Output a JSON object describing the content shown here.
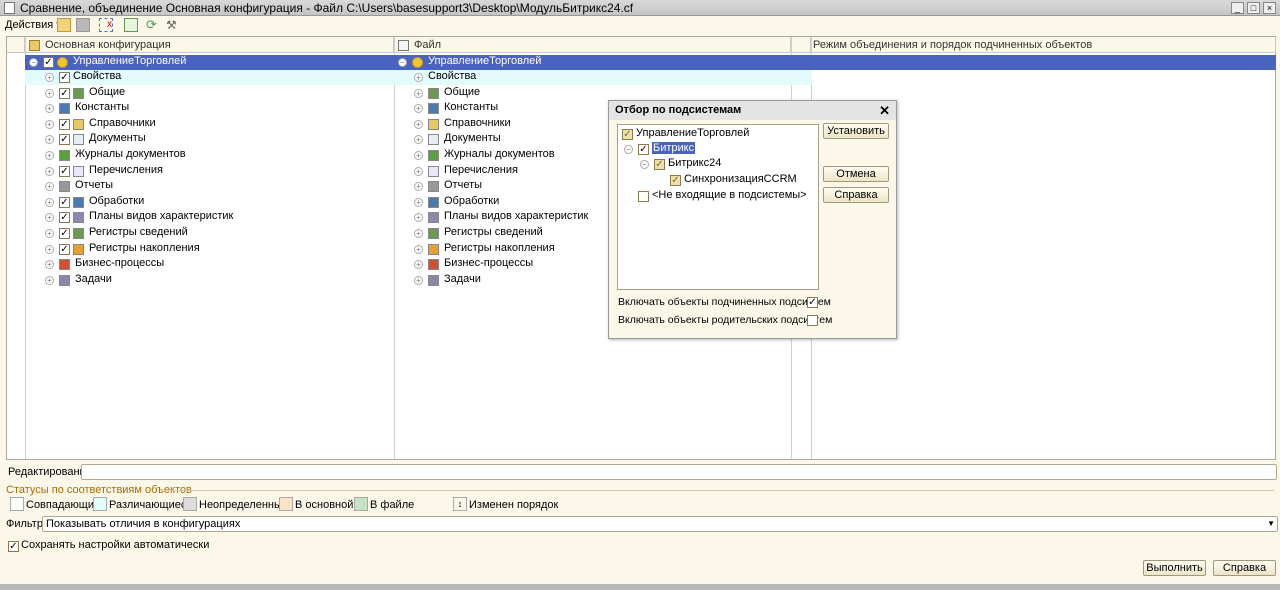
{
  "window": {
    "title": "Сравнение, объединение Основная конфигурация - Файл C:\\Users\\basesupport3\\Desktop\\МодульБитрикс24.cf"
  },
  "toolbar": {
    "actions_label": "Действия ▾",
    "icons": [
      "open-icon",
      "save-icon",
      "compare-icon",
      "subsystem-filter-icon",
      "refresh-icon",
      "settings-icon"
    ]
  },
  "tree": {
    "columns": [
      "Основная конфигурация",
      "Файл",
      "Режим объединения и порядок подчиненных объектов"
    ],
    "root": "УправлениеТорговлей",
    "items": [
      {
        "label": "Свойства",
        "checked": true
      },
      {
        "label": "Общие",
        "checked": true
      },
      {
        "label": "Константы",
        "checked": false
      },
      {
        "label": "Справочники",
        "checked": true
      },
      {
        "label": "Документы",
        "checked": true
      },
      {
        "label": "Журналы документов",
        "checked": false
      },
      {
        "label": "Перечисления",
        "checked": true
      },
      {
        "label": "Отчеты",
        "checked": false
      },
      {
        "label": "Обработки",
        "checked": true
      },
      {
        "label": "Планы видов характеристик",
        "checked": true
      },
      {
        "label": "Регистры сведений",
        "checked": true
      },
      {
        "label": "Регистры накопления",
        "checked": true
      },
      {
        "label": "Бизнес-процессы",
        "checked": false
      },
      {
        "label": "Задачи",
        "checked": false
      }
    ]
  },
  "dialog": {
    "title": "Отбор по подсистемам",
    "close": "✕",
    "items": [
      "УправлениеТорговлей",
      "Битрикс",
      "Битрикс24",
      "СинхронизацияCCRM",
      "<Не входящие в подсистемы>"
    ],
    "buttons": {
      "set": "Установить",
      "cancel": "Отмена",
      "help": "Справка"
    },
    "include_child": "Включать объекты подчиненных подсистем",
    "include_parent": "Включать объекты родительских подсистем",
    "include_child_checked": true,
    "include_parent_checked": false
  },
  "editing_label": "Редактирование:",
  "statuses": {
    "title": "Статусы по соответствиям объектов",
    "items": [
      {
        "label": "Совпадающие",
        "color": "#ffffff"
      },
      {
        "label": "Различающиеся",
        "color": "#e4fbfb"
      },
      {
        "label": "Неопределенные",
        "color": "#dcdcdc"
      },
      {
        "label": "В основной",
        "color": "#fde3c3"
      },
      {
        "label": "В файле",
        "color": "#c6e3c8"
      }
    ],
    "order_changed": "Изменен порядок"
  },
  "filter": {
    "label": "Фильтр:",
    "value": "Показывать отличия в конфигурациях"
  },
  "autosave": {
    "label": "Сохранять настройки автоматически",
    "checked": true
  },
  "footer": {
    "run": "Выполнить",
    "help": "Справка"
  }
}
